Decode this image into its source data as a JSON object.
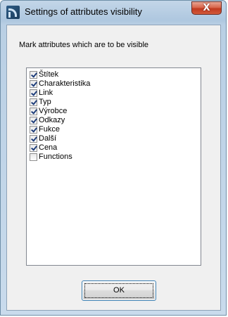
{
  "window": {
    "title": "Settings of attributes visibility",
    "close_glyph": "X"
  },
  "dialog": {
    "instruction": "Mark attributes which are to be visible",
    "ok_label": "OK"
  },
  "attributes": [
    {
      "label": "Štítek",
      "checked": true
    },
    {
      "label": "Charakteristika",
      "checked": true
    },
    {
      "label": "Link",
      "checked": true
    },
    {
      "label": "Typ",
      "checked": true
    },
    {
      "label": "Výrobce",
      "checked": true
    },
    {
      "label": "Odkazy",
      "checked": true
    },
    {
      "label": "Fukce",
      "checked": true
    },
    {
      "label": "Další",
      "checked": true
    },
    {
      "label": "Cena",
      "checked": true
    },
    {
      "label": "Functions",
      "checked": false
    }
  ]
}
